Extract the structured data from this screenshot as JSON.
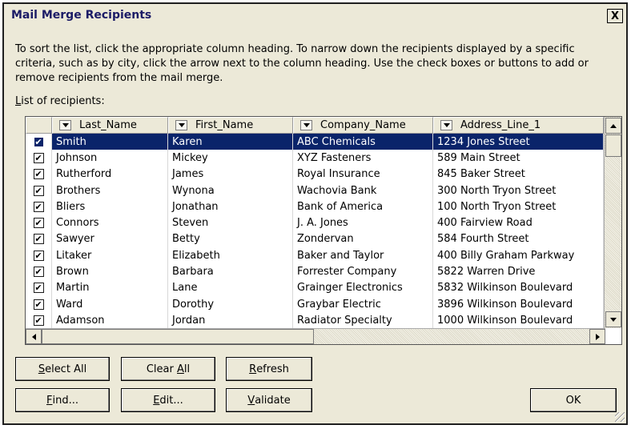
{
  "window": {
    "title": "Mail Merge Recipients",
    "close_label": "X"
  },
  "instructions": "To sort the list, click the appropriate column heading.  To narrow down the recipients displayed by a specific criteria, such as by city, click the arrow next to the column heading.  Use the check boxes or buttons to add or remove recipients from the mail merge.",
  "list_label": {
    "mnemonic": "L",
    "rest": "ist of recipients:"
  },
  "columns": [
    "Last_Name",
    "First_Name",
    "Company_Name",
    "Address_Line_1"
  ],
  "rows": [
    {
      "checked": true,
      "selected": true,
      "cells": [
        "Smith",
        "Karen",
        "ABC Chemicals",
        "1234 Jones Street"
      ]
    },
    {
      "checked": true,
      "selected": false,
      "cells": [
        "Johnson",
        "Mickey",
        "XYZ Fasteners",
        "589 Main Street"
      ]
    },
    {
      "checked": true,
      "selected": false,
      "cells": [
        "Rutherford",
        "James",
        "Royal Insurance",
        "845 Baker Street"
      ]
    },
    {
      "checked": true,
      "selected": false,
      "cells": [
        "Brothers",
        "Wynona",
        "Wachovia Bank",
        "300 North Tryon Street"
      ]
    },
    {
      "checked": true,
      "selected": false,
      "cells": [
        "Bliers",
        "Jonathan",
        "Bank of America",
        "100 North Tryon Street"
      ]
    },
    {
      "checked": true,
      "selected": false,
      "cells": [
        "Connors",
        "Steven",
        "J. A. Jones",
        "400 Fairview Road"
      ]
    },
    {
      "checked": true,
      "selected": false,
      "cells": [
        "Sawyer",
        "Betty",
        "Zondervan",
        "584 Fourth Street"
      ]
    },
    {
      "checked": true,
      "selected": false,
      "cells": [
        "Litaker",
        "Elizabeth",
        "Baker and Taylor",
        "400 Billy Graham Parkway"
      ]
    },
    {
      "checked": true,
      "selected": false,
      "cells": [
        "Brown",
        "Barbara",
        "Forrester Company",
        "5822 Warren Drive"
      ]
    },
    {
      "checked": true,
      "selected": false,
      "cells": [
        "Martin",
        "Lane",
        "Grainger Electronics",
        "5832 Wilkinson Boulevard"
      ]
    },
    {
      "checked": true,
      "selected": false,
      "cells": [
        "Ward",
        "Dorothy",
        "Graybar Electric",
        "3896 Wilkinson Boulevard"
      ]
    },
    {
      "checked": true,
      "selected": false,
      "cells": [
        "Adamson",
        "Jordan",
        "Radiator Specialty",
        "1000 Wilkinson Boulevard"
      ]
    }
  ],
  "buttons": {
    "select_all": {
      "mnemonic": "S",
      "rest": "elect All"
    },
    "clear_all": {
      "pre": "Clear ",
      "mnemonic": "A",
      "rest": "ll"
    },
    "refresh": {
      "mnemonic": "R",
      "rest": "efresh"
    },
    "find": {
      "mnemonic": "F",
      "rest": "ind..."
    },
    "edit": {
      "mnemonic": "E",
      "rest": "dit..."
    },
    "validate": {
      "mnemonic": "V",
      "rest": "alidate"
    },
    "ok": "OK"
  },
  "check_glyph": "✔"
}
